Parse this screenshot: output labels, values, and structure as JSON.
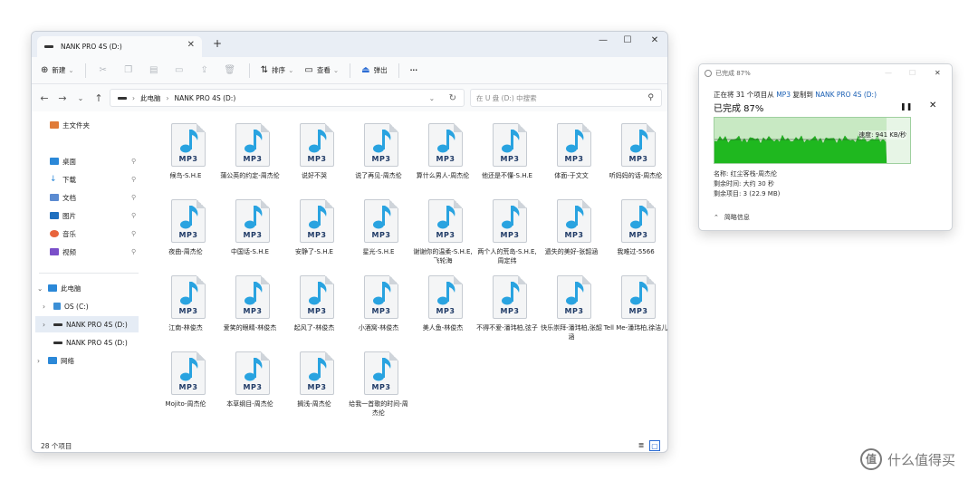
{
  "explorer": {
    "tab_title": "NANK PRO 4S (D:)",
    "toolbar": {
      "new_label": "新建",
      "sort_label": "排序",
      "view_label": "查看",
      "eject_label": "弹出",
      "more_label": "···"
    },
    "address": {
      "crumb1": "此电脑",
      "crumb2": "NANK PRO 4S (D:)",
      "search_placeholder": "在 U 盘 (D:) 中搜索"
    },
    "sidebar": {
      "home": "主文件夹",
      "desktop": "桌面",
      "downloads": "下载",
      "documents": "文档",
      "pictures": "图片",
      "music": "音乐",
      "videos": "视频",
      "this_pc": "此电脑",
      "os": "OS (C:)",
      "drive_d": "NANK PRO 4S (D:)",
      "drive_d2": "NANK PRO 4S (D:)",
      "network": "网络"
    },
    "file_badge": "MP3",
    "files": [
      "候鸟-S.H.E",
      "蒲公英的约定-周杰伦",
      "说好不哭",
      "说了再见-周杰伦",
      "算什么男人-周杰伦",
      "他还是不懂-S.H.E",
      "体面-于文文",
      "听妈妈的话-周杰伦",
      "夜曲-周杰伦",
      "中国话-S.H.E",
      "安静了-S.H.E",
      "星光-S.H.E",
      "谢谢你的温柔-S.H.E,飞轮海",
      "两个人的荒岛-S.H.E,周定纬",
      "遗失的美好-张韶涵",
      "我难过-5566",
      "江南-林俊杰",
      "爱笑的眼睛-林俊杰",
      "起风了-林俊杰",
      "小酒窝-林俊杰",
      "美人鱼-林俊杰",
      "不得不爱-潘玮柏,弦子",
      "快乐崇拜-潘玮柏,张韶涵",
      "Tell Me-潘玮柏,徐洁儿",
      "Mojito-周杰伦",
      "本草纲目-周杰伦",
      "搁浅-周杰伦",
      "给我一首歌的时间-周杰伦"
    ],
    "status": "28 个项目"
  },
  "dialog": {
    "title": "已完成 87%",
    "line_prefix": "正在将 31 个项目从 ",
    "line_src": "MP3",
    "line_mid": " 复制到 ",
    "line_dst": "NANK PRO 4S (D:)",
    "percent_text": "已完成 87%",
    "progress_fraction": 0.87,
    "speed": "速度: 941 KB/秒",
    "name": "名称: 红尘客栈-周杰伦",
    "time_left": "剩余时间: 大约 30 秒",
    "items_left": "剩余项目: 3 (22.9 MB)",
    "details": "简略信息"
  },
  "watermark": "什么值得买",
  "watermark_logo": "值"
}
